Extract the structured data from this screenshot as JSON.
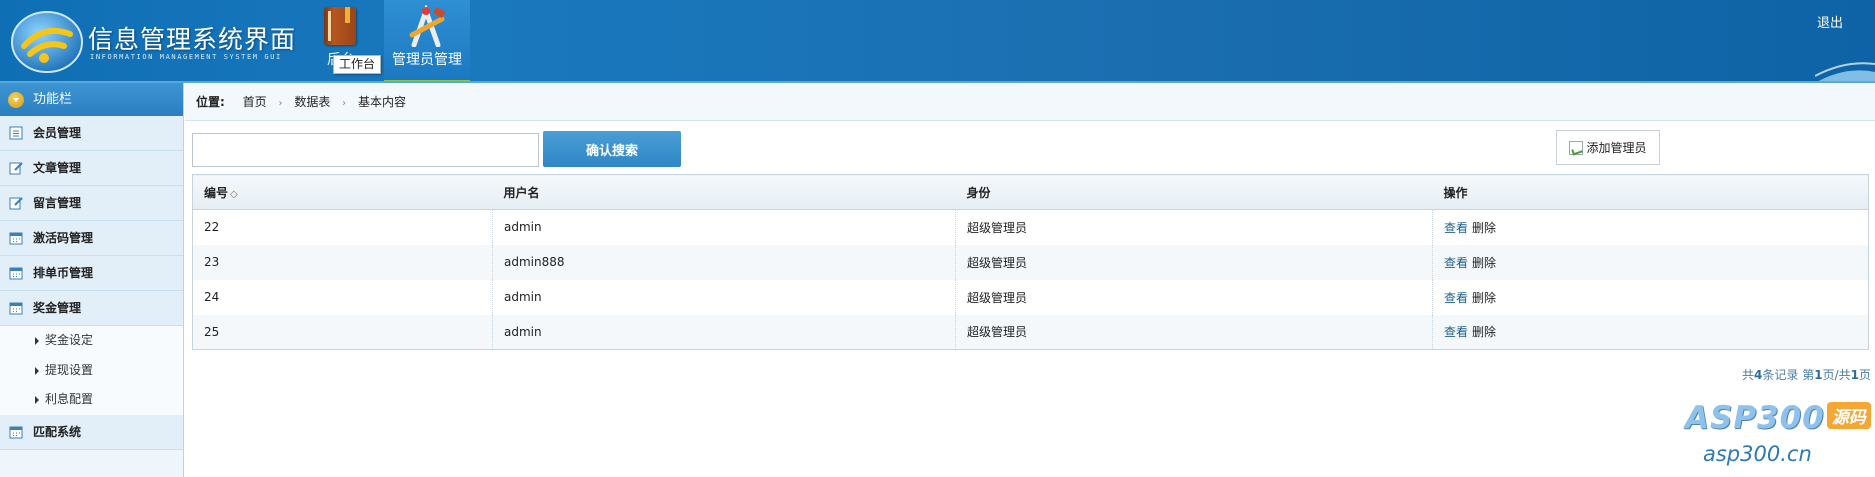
{
  "header": {
    "site_title": "信息管理系统界面",
    "site_subtitle": "INFORMATION MANAGEMENT SYSTEM GUI",
    "nav": [
      {
        "label": "后台",
        "icon": "book-icon"
      },
      {
        "label": "管理员管理",
        "icon": "tools-icon"
      }
    ],
    "tooltip": "工作台",
    "logout_label": "退出"
  },
  "sidebar": {
    "title": "功能栏",
    "items": [
      {
        "label": "会员管理",
        "icon": "list-icon"
      },
      {
        "label": "文章管理",
        "icon": "edit-icon"
      },
      {
        "label": "留言管理",
        "icon": "edit-icon"
      },
      {
        "label": "激活码管理",
        "icon": "calendar-icon"
      },
      {
        "label": "排单币管理",
        "icon": "calendar-icon"
      },
      {
        "label": "奖金管理",
        "icon": "calendar-icon"
      }
    ],
    "sub_items": [
      {
        "label": "奖金设定"
      },
      {
        "label": "提现设置"
      },
      {
        "label": "利息配置"
      }
    ],
    "last_item": {
      "label": "匹配系统",
      "icon": "calendar-icon"
    }
  },
  "breadcrumb": {
    "label": "位置:",
    "items": [
      "首页",
      "数据表",
      "基本内容"
    ]
  },
  "toolbar": {
    "search_value": "",
    "search_button": "确认搜索",
    "add_button": "添加管理员"
  },
  "table": {
    "columns": [
      "编号",
      "用户名",
      "身份",
      "操作"
    ],
    "rows": [
      {
        "id": "22",
        "username": "admin",
        "role": "超级管理员",
        "view": "查看",
        "delete": "删除"
      },
      {
        "id": "23",
        "username": "admin888",
        "role": "超级管理员",
        "view": "查看",
        "delete": "删除"
      },
      {
        "id": "24",
        "username": "admin",
        "role": "超级管理员",
        "view": "查看",
        "delete": "删除"
      },
      {
        "id": "25",
        "username": "admin",
        "role": "超级管理员",
        "view": "查看",
        "delete": "删除"
      }
    ]
  },
  "pager": {
    "prefix": "共",
    "count": "4",
    "records": "条记录 第",
    "page": "1",
    "sep": "页/共",
    "total": "1",
    "suffix": "页"
  },
  "watermark": {
    "brand": "ASP300",
    "badge": "源码",
    "domain": "asp300.cn"
  },
  "colors": {
    "header_bg": "#1b6fb1",
    "accent": "#2f86c4",
    "link": "#1f5f8b"
  }
}
